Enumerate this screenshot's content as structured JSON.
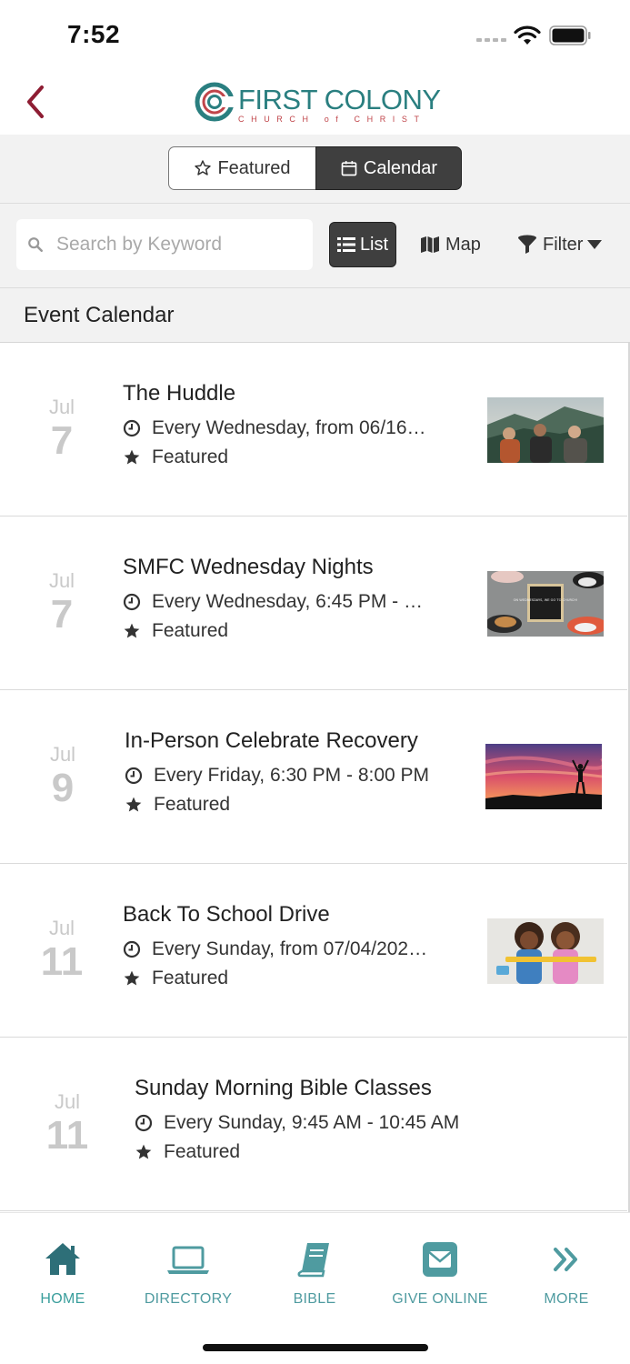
{
  "status": {
    "time": "7:52"
  },
  "header": {
    "logo_title": "FIRST COLONY",
    "logo_subtitle": "CHURCH of CHRIST"
  },
  "segments": {
    "featured": "Featured",
    "calendar": "Calendar",
    "selected": "Calendar"
  },
  "toolbar": {
    "search_placeholder": "Search by Keyword",
    "list_label": "List",
    "map_label": "Map",
    "filter_label": "Filter"
  },
  "section": {
    "title": "Event Calendar"
  },
  "events": [
    {
      "month": "Jul",
      "day": "7",
      "title": "The Huddle",
      "schedule": "Every Wednesday, from 06/16…",
      "tag": "Featured",
      "thumb": "mountain-friends-photo"
    },
    {
      "month": "Jul",
      "day": "7",
      "title": "SMFC Wednesday Nights",
      "schedule": "Every Wednesday, 6:45 PM - …",
      "tag": "Featured",
      "thumb": "shoes-chalkboard-photo",
      "thumb_text": "ON WEDNESDAYS, WE GO TO CHURCH!"
    },
    {
      "month": "Jul",
      "day": "9",
      "title": "In-Person Celebrate Recovery",
      "schedule": "Every Friday, 6:30 PM - 8:00 PM",
      "tag": "Featured",
      "thumb": "sunset-silhouette-photo"
    },
    {
      "month": "Jul",
      "day": "11",
      "title": "Back To School Drive",
      "schedule": "Every Sunday, from 07/04/202…",
      "tag": "Featured",
      "thumb": "kids-school-photo"
    },
    {
      "month": "Jul",
      "day": "11",
      "title": "Sunday Morning Bible Classes",
      "schedule": "Every Sunday, 9:45 AM - 10:45 AM",
      "tag": "Featured"
    }
  ],
  "tabs": [
    {
      "label": "HOME",
      "icon": "home-icon",
      "active": true
    },
    {
      "label": "DIRECTORY",
      "icon": "laptop-icon"
    },
    {
      "label": "BIBLE",
      "icon": "book-icon"
    },
    {
      "label": "GIVE ONLINE",
      "icon": "envelope-icon"
    },
    {
      "label": "MORE",
      "icon": "double-chevron-icon"
    }
  ],
  "colors": {
    "brand_teal": "#2a7f80",
    "brand_red": "#c0454a",
    "back_arrow": "#8e1d33",
    "tab_teal": "#4f9ba0"
  }
}
